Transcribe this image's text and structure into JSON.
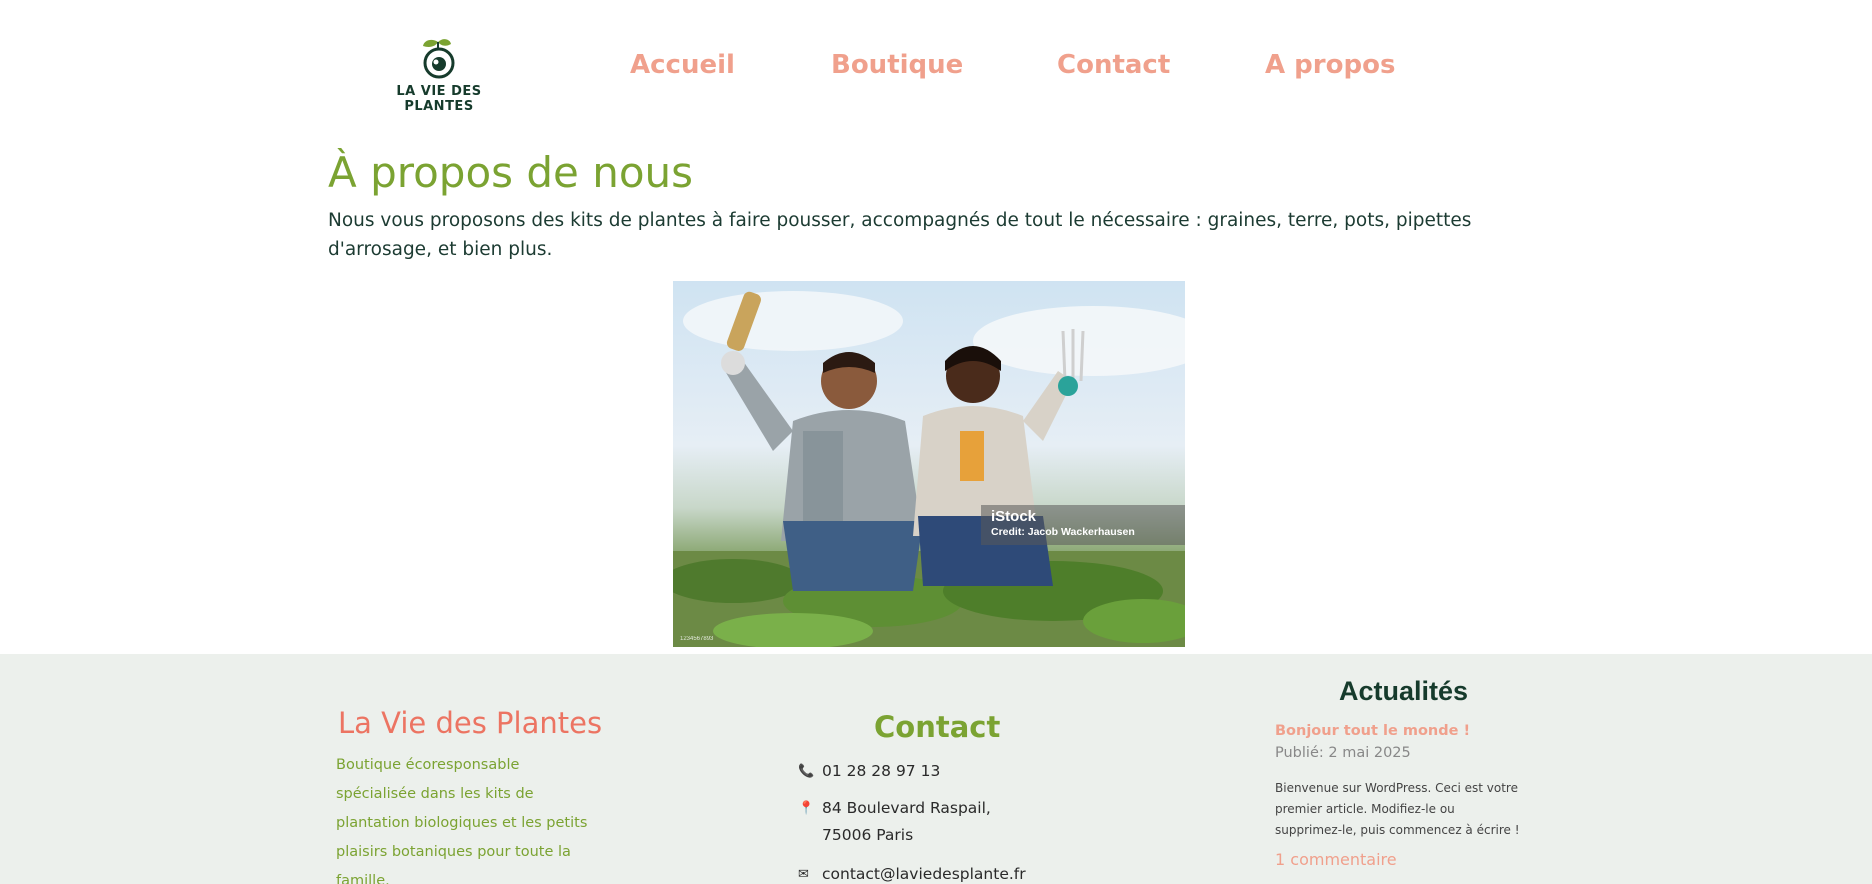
{
  "header": {
    "logo_line1": "LA VIE DES",
    "logo_line2": "PLANTES",
    "nav": [
      "Accueil",
      "Boutique",
      "Contact",
      "A propos"
    ]
  },
  "main": {
    "title": "À propos de nous",
    "intro": "Nous vous proposons des kits de plantes à faire pousser, accompagnés de tout le nécessaire : graines, terre, pots, pipettes d'arrosage, et bien plus.",
    "photo": {
      "watermark_brand": "iStock",
      "watermark_credit": "Credit: Jacob Wackerhausen",
      "watermark_small": "1234567893"
    }
  },
  "footer": {
    "brand": {
      "name": "La Vie des Plantes",
      "description": "Boutique écoresponsable spécialisée dans les kits de plantation biologiques et les petits plaisirs botaniques pour toute la famille."
    },
    "contact": {
      "title": "Contact",
      "phone": "01 28 28 97 13",
      "address": "84 Boulevard Raspail, 75006 Paris",
      "email": "contact@laviedesplante.fr",
      "phone_icon": "phone-icon",
      "address_icon": "map-pin-icon",
      "email_icon": "envelope-icon"
    },
    "news": {
      "title": "Actualités",
      "post_title": "Bonjour tout le monde !",
      "post_date": "Publié: 2 mai 2025",
      "post_excerpt": "Bienvenue sur WordPress. Ceci est votre premier article. Modifiez-le ou supprimez-le, puis commencez à écrire !",
      "post_comments": "1 commentaire"
    }
  },
  "colors": {
    "accent_green": "#7ba332",
    "nav_salmon": "#f0a08c",
    "brand_coral": "#ec7462",
    "dark_green": "#163b2c",
    "footer_bg": "#ecf0ec"
  }
}
